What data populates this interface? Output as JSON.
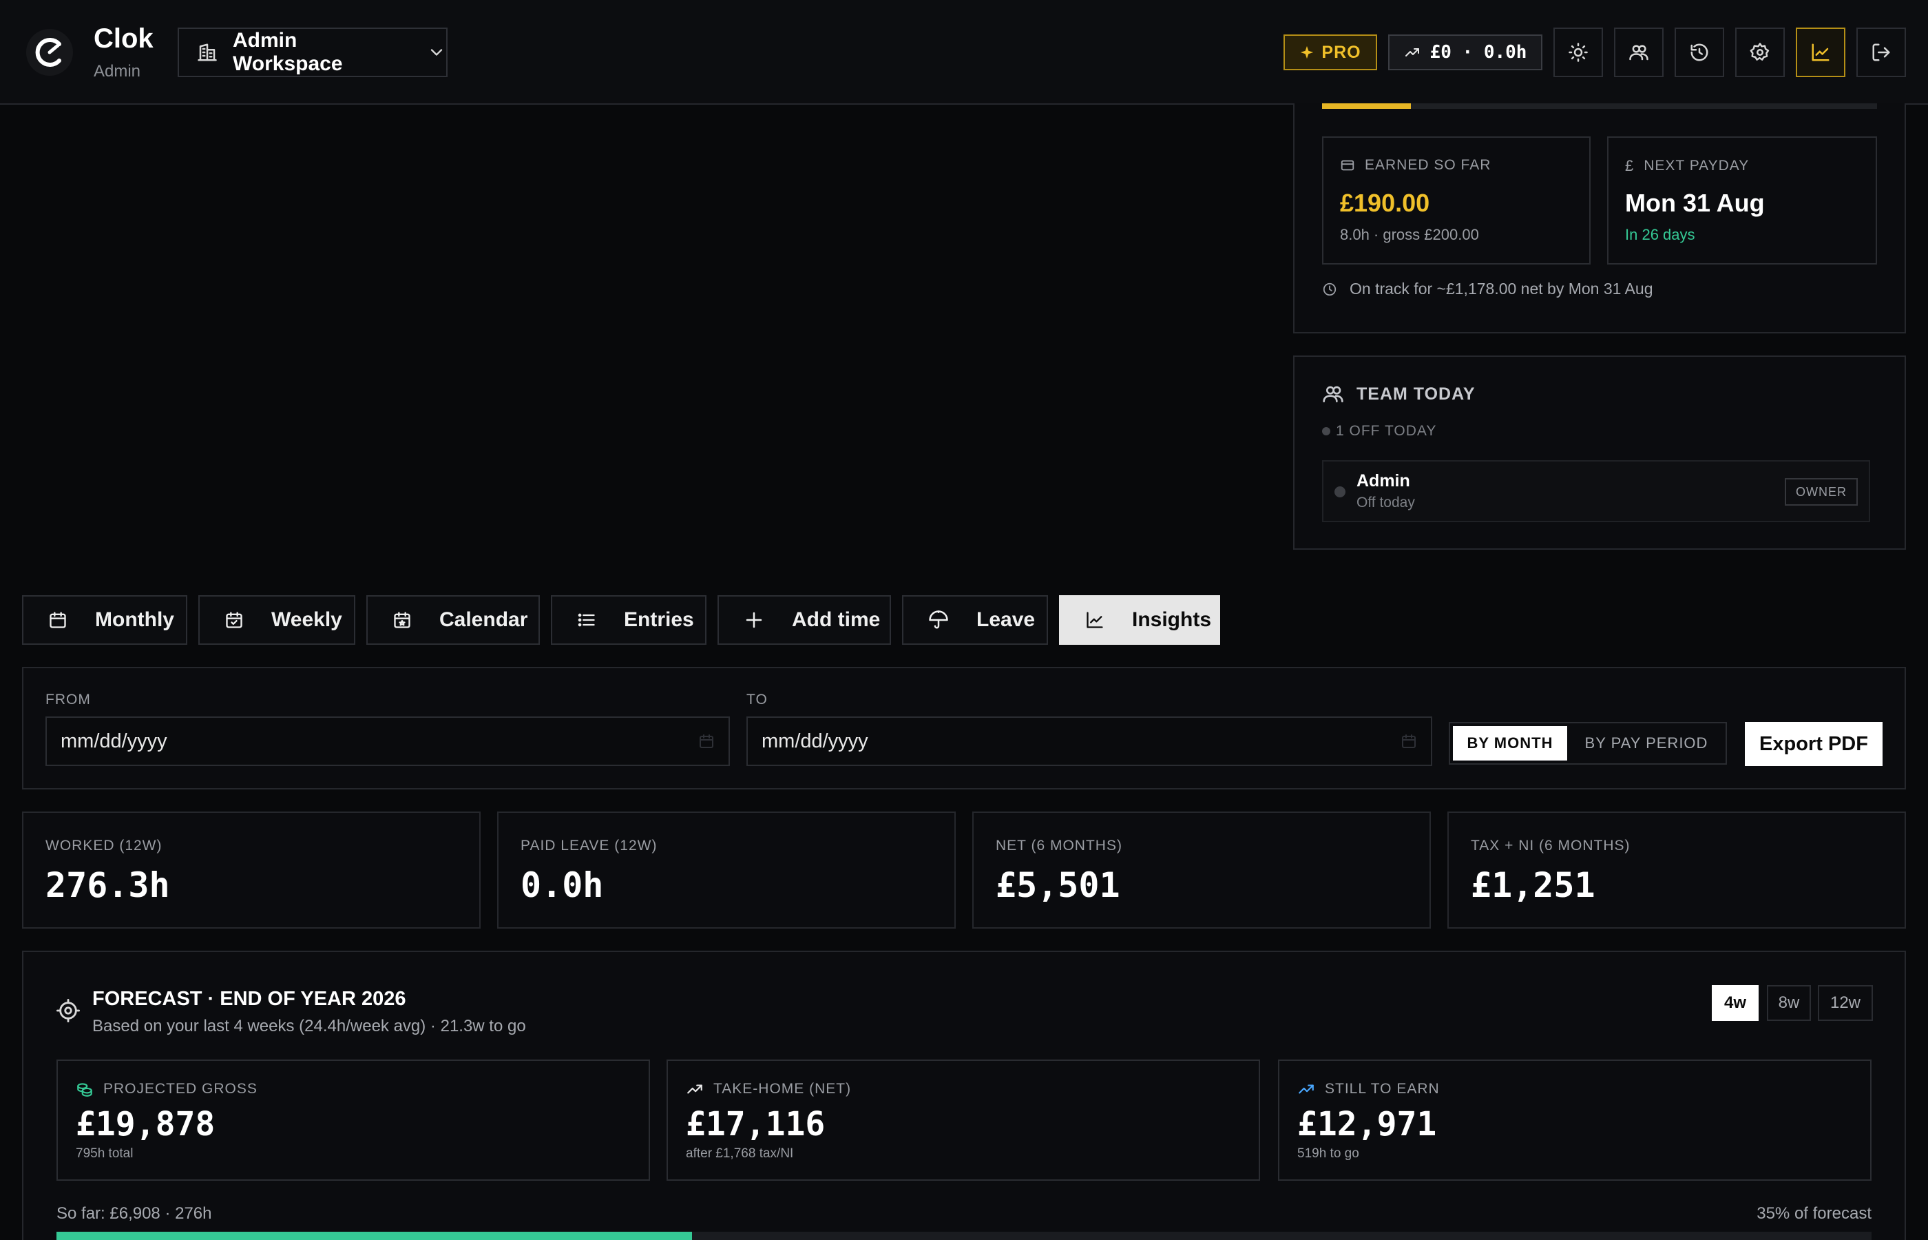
{
  "header": {
    "app_title": "Clok",
    "app_sub": "Admin",
    "workspace": "Admin Workspace",
    "pro_label": "PRO",
    "earnings_pill": "£0 · 0.0h",
    "icons": [
      "sun-icon",
      "team-icon",
      "history-icon",
      "gear-icon",
      "chart-icon",
      "logout-icon"
    ]
  },
  "pay_panel": {
    "progress_fraction": 0.16,
    "earned_label": "EARNED SO FAR",
    "earned_value": "£190.00",
    "earned_sub": "8.0h · gross £200.00",
    "payday_label": "NEXT PAYDAY",
    "payday_value": "Mon 31 Aug",
    "payday_sub": "In 26 days",
    "on_track": "On track for ~£1,178.00 net by Mon 31 Aug"
  },
  "team": {
    "title": "TEAM TODAY",
    "off_count": "1 OFF TODAY",
    "members": [
      {
        "name": "Admin",
        "status": "Off today",
        "role": "OWNER"
      }
    ]
  },
  "tabs": [
    {
      "label": "Monthly",
      "icon": "calendar-icon"
    },
    {
      "label": "Weekly",
      "icon": "calendar-check-icon"
    },
    {
      "label": "Calendar",
      "icon": "calendar-star-icon"
    },
    {
      "label": "Entries",
      "icon": "list-icon"
    },
    {
      "label": "Add time",
      "icon": "plus-icon"
    },
    {
      "label": "Leave",
      "icon": "umbrella-icon"
    },
    {
      "label": "Insights",
      "icon": "chart-icon",
      "active": true
    }
  ],
  "filter": {
    "from_label": "FROM",
    "from_value": "mm/dd/yyyy",
    "to_label": "TO",
    "to_value": "mm/dd/yyyy",
    "group_options": [
      "BY MONTH",
      "BY PAY PERIOD"
    ],
    "group_selected": "BY MONTH",
    "export_label": "Export PDF"
  },
  "stats": [
    {
      "label": "WORKED (12W)",
      "value": "276.3h"
    },
    {
      "label": "PAID LEAVE (12W)",
      "value": "0.0h"
    },
    {
      "label": "NET (6 MONTHS)",
      "value": "£5,501"
    },
    {
      "label": "TAX + NI (6 MONTHS)",
      "value": "£1,251"
    }
  ],
  "forecast": {
    "title": "FORECAST · END OF YEAR 2026",
    "subtitle": "Based on your last 4 weeks (24.4h/week avg) · 21.3w to go",
    "windows": [
      "4w",
      "8w",
      "12w"
    ],
    "window_selected": "4w",
    "cards": [
      {
        "label": "PROJECTED GROSS",
        "value": "£19,878",
        "sub": "795h total",
        "icon": "coins-icon",
        "color": "#35c995"
      },
      {
        "label": "TAKE-HOME (NET)",
        "value": "£17,116",
        "sub": "after £1,768 tax/NI",
        "icon": "trend-up-icon",
        "color": "#e8e8e8"
      },
      {
        "label": "STILL TO EARN",
        "value": "£12,971",
        "sub": "519h to go",
        "icon": "trend-up-icon",
        "color": "#4aa8ff"
      }
    ],
    "so_far": "So far: £6,908 · 276h",
    "percent_label": "35% of forecast",
    "progress_fraction": 0.35
  },
  "colors": {
    "accent": "#f0c02a",
    "positive": "#35c995",
    "background": "#08090b"
  }
}
